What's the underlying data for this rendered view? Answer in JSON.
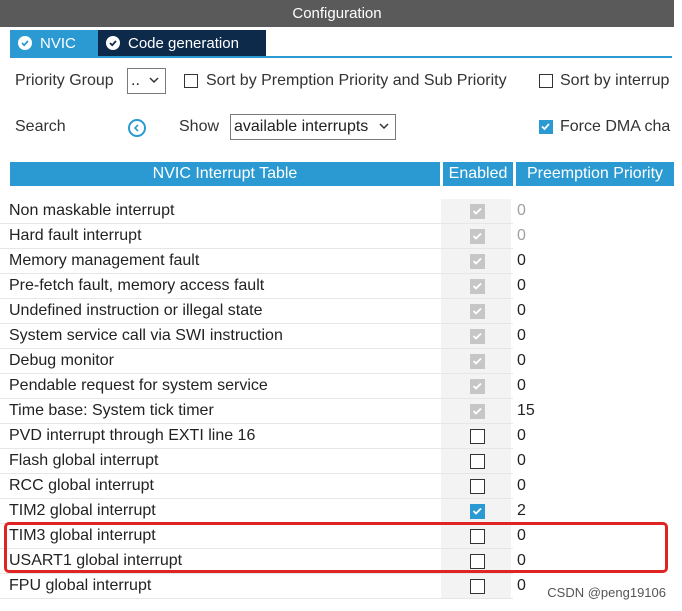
{
  "window": {
    "title": "Configuration"
  },
  "tabs": [
    {
      "label": "NVIC",
      "active": true
    },
    {
      "label": "Code generation",
      "active": false
    }
  ],
  "toolbar": {
    "priority_group_label": "Priority Group",
    "priority_group_value": "..",
    "sort_premption_label": "Sort by Premption Priority and Sub Priority",
    "sort_interrupts_label": "Sort by interrup",
    "search_label": "Search",
    "show_label": "Show",
    "show_value": "available interrupts",
    "force_dma_label": "Force DMA cha"
  },
  "table": {
    "headers": [
      "NVIC Interrupt Table",
      "Enabled",
      "Preemption Priority"
    ],
    "rows": [
      {
        "name": "Non maskable interrupt",
        "enabled": "fixed",
        "priority": "0",
        "priority_disabled": true
      },
      {
        "name": "Hard fault interrupt",
        "enabled": "fixed",
        "priority": "0",
        "priority_disabled": true
      },
      {
        "name": "Memory management fault",
        "enabled": "fixed",
        "priority": "0",
        "priority_disabled": false
      },
      {
        "name": "Pre-fetch fault, memory access fault",
        "enabled": "fixed",
        "priority": "0",
        "priority_disabled": false
      },
      {
        "name": "Undefined instruction or illegal state",
        "enabled": "fixed",
        "priority": "0",
        "priority_disabled": false
      },
      {
        "name": "System service call via SWI instruction",
        "enabled": "fixed",
        "priority": "0",
        "priority_disabled": false
      },
      {
        "name": "Debug monitor",
        "enabled": "fixed",
        "priority": "0",
        "priority_disabled": false
      },
      {
        "name": "Pendable request for system service",
        "enabled": "fixed",
        "priority": "0",
        "priority_disabled": false
      },
      {
        "name": "Time base: System tick timer",
        "enabled": "fixed",
        "priority": "15",
        "priority_disabled": false
      },
      {
        "name": "PVD interrupt through EXTI line 16",
        "enabled": "off",
        "priority": "0",
        "priority_disabled": false
      },
      {
        "name": "Flash global interrupt",
        "enabled": "off",
        "priority": "0",
        "priority_disabled": false
      },
      {
        "name": "RCC global interrupt",
        "enabled": "off",
        "priority": "0",
        "priority_disabled": false
      },
      {
        "name": "TIM2 global interrupt",
        "enabled": "on",
        "priority": "2",
        "priority_disabled": false
      },
      {
        "name": "TIM3 global interrupt",
        "enabled": "off",
        "priority": "0",
        "priority_disabled": false
      },
      {
        "name": "USART1 global interrupt",
        "enabled": "off",
        "priority": "0",
        "priority_disabled": false
      },
      {
        "name": "FPU global interrupt",
        "enabled": "off",
        "priority": "0",
        "priority_disabled": false
      }
    ]
  },
  "watermark": "CSDN @peng19106",
  "colors": {
    "accent": "#2b9ad2",
    "title_bar": "#5a5a5a",
    "dark_tab": "#0d2a4a",
    "highlight": "#e02424"
  }
}
